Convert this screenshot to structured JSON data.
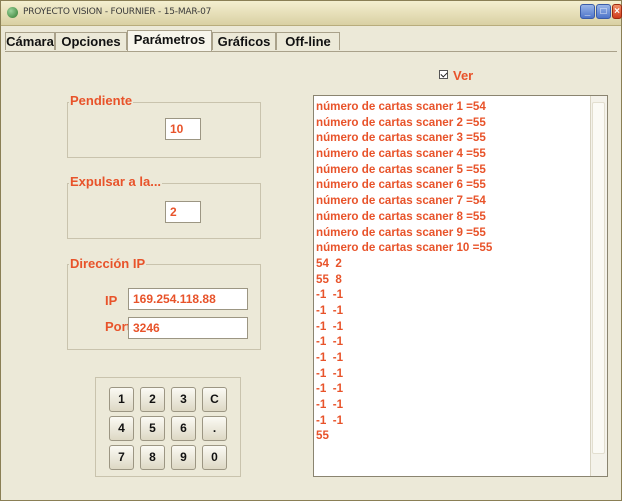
{
  "window": {
    "title": "PROYECTO VISION - FOURNIER - 15-MAR-07"
  },
  "tabs": [
    {
      "label": "Cámara"
    },
    {
      "label": "Opciones"
    },
    {
      "label": "Parámetros",
      "active": true
    },
    {
      "label": "Gráficos"
    },
    {
      "label": "Off-line"
    }
  ],
  "pendiente": {
    "title": "Pendiente",
    "value": "10"
  },
  "expulsar": {
    "title": "Expulsar a la...",
    "value": "2"
  },
  "direccion": {
    "title": "Dirección IP",
    "ip_label": "IP",
    "ip_value": "169.254.118.88",
    "port_label": "Port",
    "port_value": "3246"
  },
  "keypad": {
    "keys": [
      "1",
      "2",
      "3",
      "C",
      "4",
      "5",
      "6",
      ".",
      "7",
      "8",
      "9",
      "0"
    ]
  },
  "ver": {
    "label": "Ver",
    "checked": true
  },
  "output": {
    "lines": [
      "número de cartas scaner 1 =54",
      "número de cartas scaner 2 =55",
      "número de cartas scaner 3 =55",
      "número de cartas scaner 4 =55",
      "número de cartas scaner 5 =55",
      "número de cartas scaner 6 =55",
      "número de cartas scaner 7 =54",
      "número de cartas scaner 8 =55",
      "número de cartas scaner 9 =55",
      "número de cartas scaner 10 =55",
      "54  2",
      "55  8",
      "-1  -1",
      "-1  -1",
      "-1  -1",
      "-1  -1",
      "-1  -1",
      "-1  -1",
      "-1  -1",
      "-1  -1",
      "-1  -1",
      "55"
    ]
  },
  "colors": {
    "accent": "#e8532a",
    "background": "#ece9d8"
  }
}
